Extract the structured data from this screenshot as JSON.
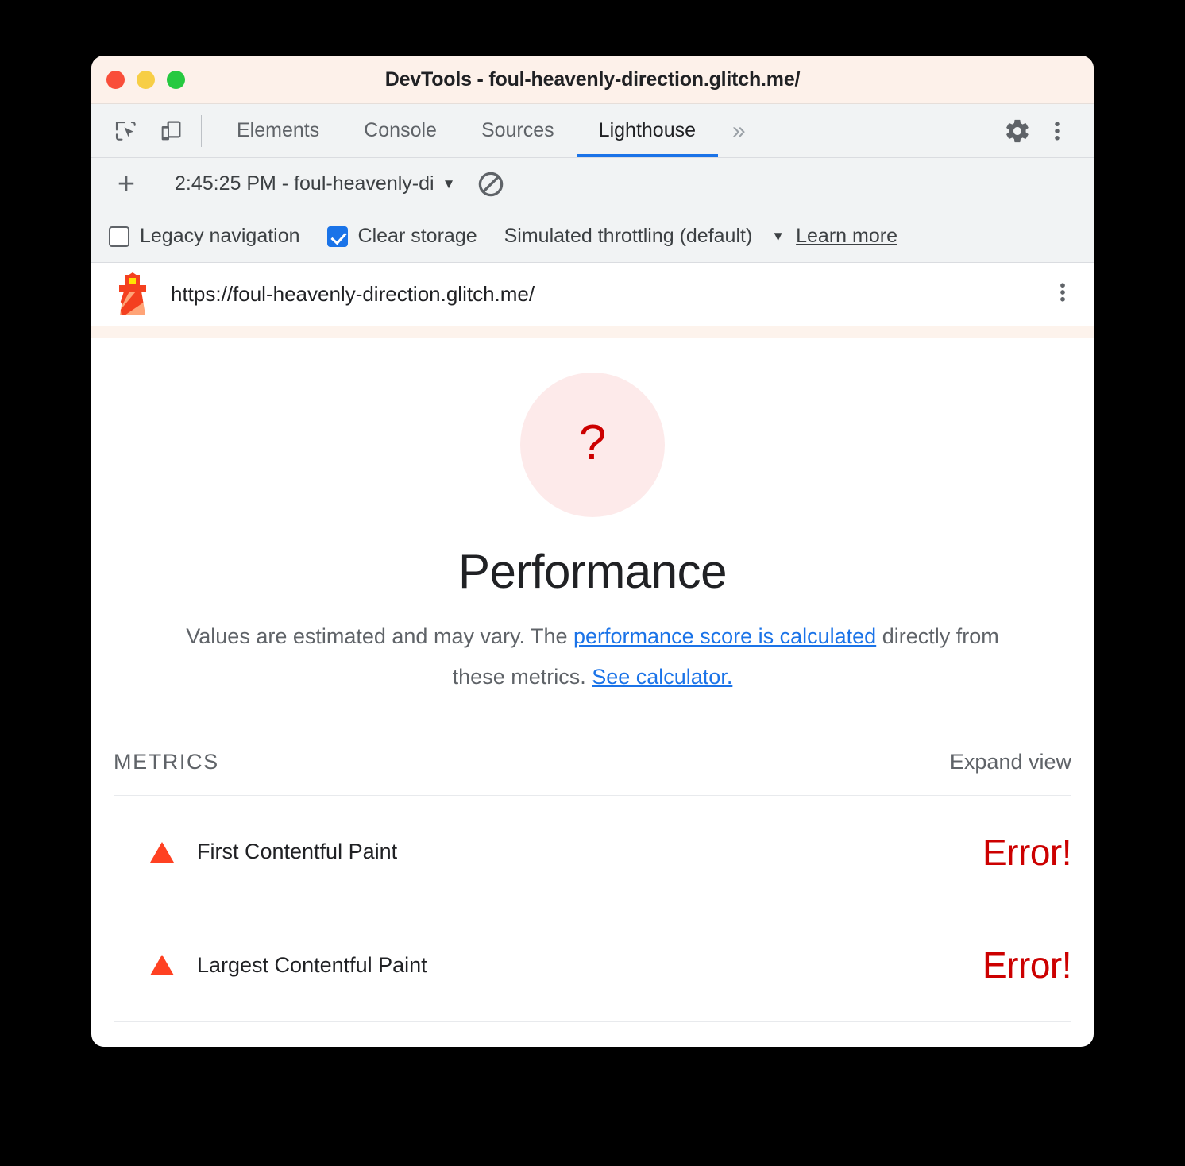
{
  "window": {
    "title": "DevTools - foul-heavenly-direction.glitch.me/",
    "traffic_lights": [
      {
        "name": "close",
        "color": "#f94e3a"
      },
      {
        "name": "minimize",
        "color": "#f7ce46"
      },
      {
        "name": "maximize",
        "color": "#26c940"
      }
    ]
  },
  "tabbar": {
    "left_icons": [
      {
        "name": "inspect-element-icon"
      },
      {
        "name": "device-toolbar-icon"
      }
    ],
    "tabs": [
      {
        "label": "Elements",
        "active": false
      },
      {
        "label": "Console",
        "active": false
      },
      {
        "label": "Sources",
        "active": false
      },
      {
        "label": "Lighthouse",
        "active": true
      }
    ],
    "more_tabs_label": "»",
    "right_icons": [
      {
        "name": "settings-gear-icon"
      },
      {
        "name": "more-options-kebab-icon"
      }
    ],
    "active_tab_underline_color": "#1a73e8"
  },
  "lighthouse_toolbar": {
    "add_label": "+",
    "report_name": "2:45:25 PM - foul-heavenly-di",
    "dropdown_caret": "▼",
    "clear_icon_name": "clear-all-icon"
  },
  "options": {
    "legacy_navigation": {
      "label": "Legacy navigation",
      "checked": false
    },
    "clear_storage": {
      "label": "Clear storage",
      "checked": true
    },
    "throttling": {
      "label": "Simulated throttling (default)",
      "caret": "▼"
    },
    "learn_more": "Learn more",
    "checkbox_accent": "#1a73e8"
  },
  "urlbar": {
    "icon_name": "lighthouse-logo-icon",
    "url": "https://foul-heavenly-direction.glitch.me/",
    "kebab_name": "report-options-kebab-icon"
  },
  "report": {
    "gauge": {
      "symbol": "?",
      "fill": "#fdeaea",
      "text_color": "#cc0000"
    },
    "category_title": "Performance",
    "description": {
      "part1": "Values are estimated and may vary. The ",
      "link1": "performance score is calculated",
      "part2": " directly from these metrics. ",
      "link2": "See calculator.",
      "link_color": "#1a73e8"
    },
    "metrics_section": {
      "label": "METRICS",
      "expand_view": "Expand view",
      "rows": [
        {
          "icon": "triangle-warning-icon",
          "name": "First Contentful Paint",
          "value": "Error!"
        },
        {
          "icon": "triangle-warning-icon",
          "name": "Largest Contentful Paint",
          "value": "Error!"
        }
      ],
      "error_color": "#cc0000",
      "icon_color": "#ff4122"
    }
  }
}
